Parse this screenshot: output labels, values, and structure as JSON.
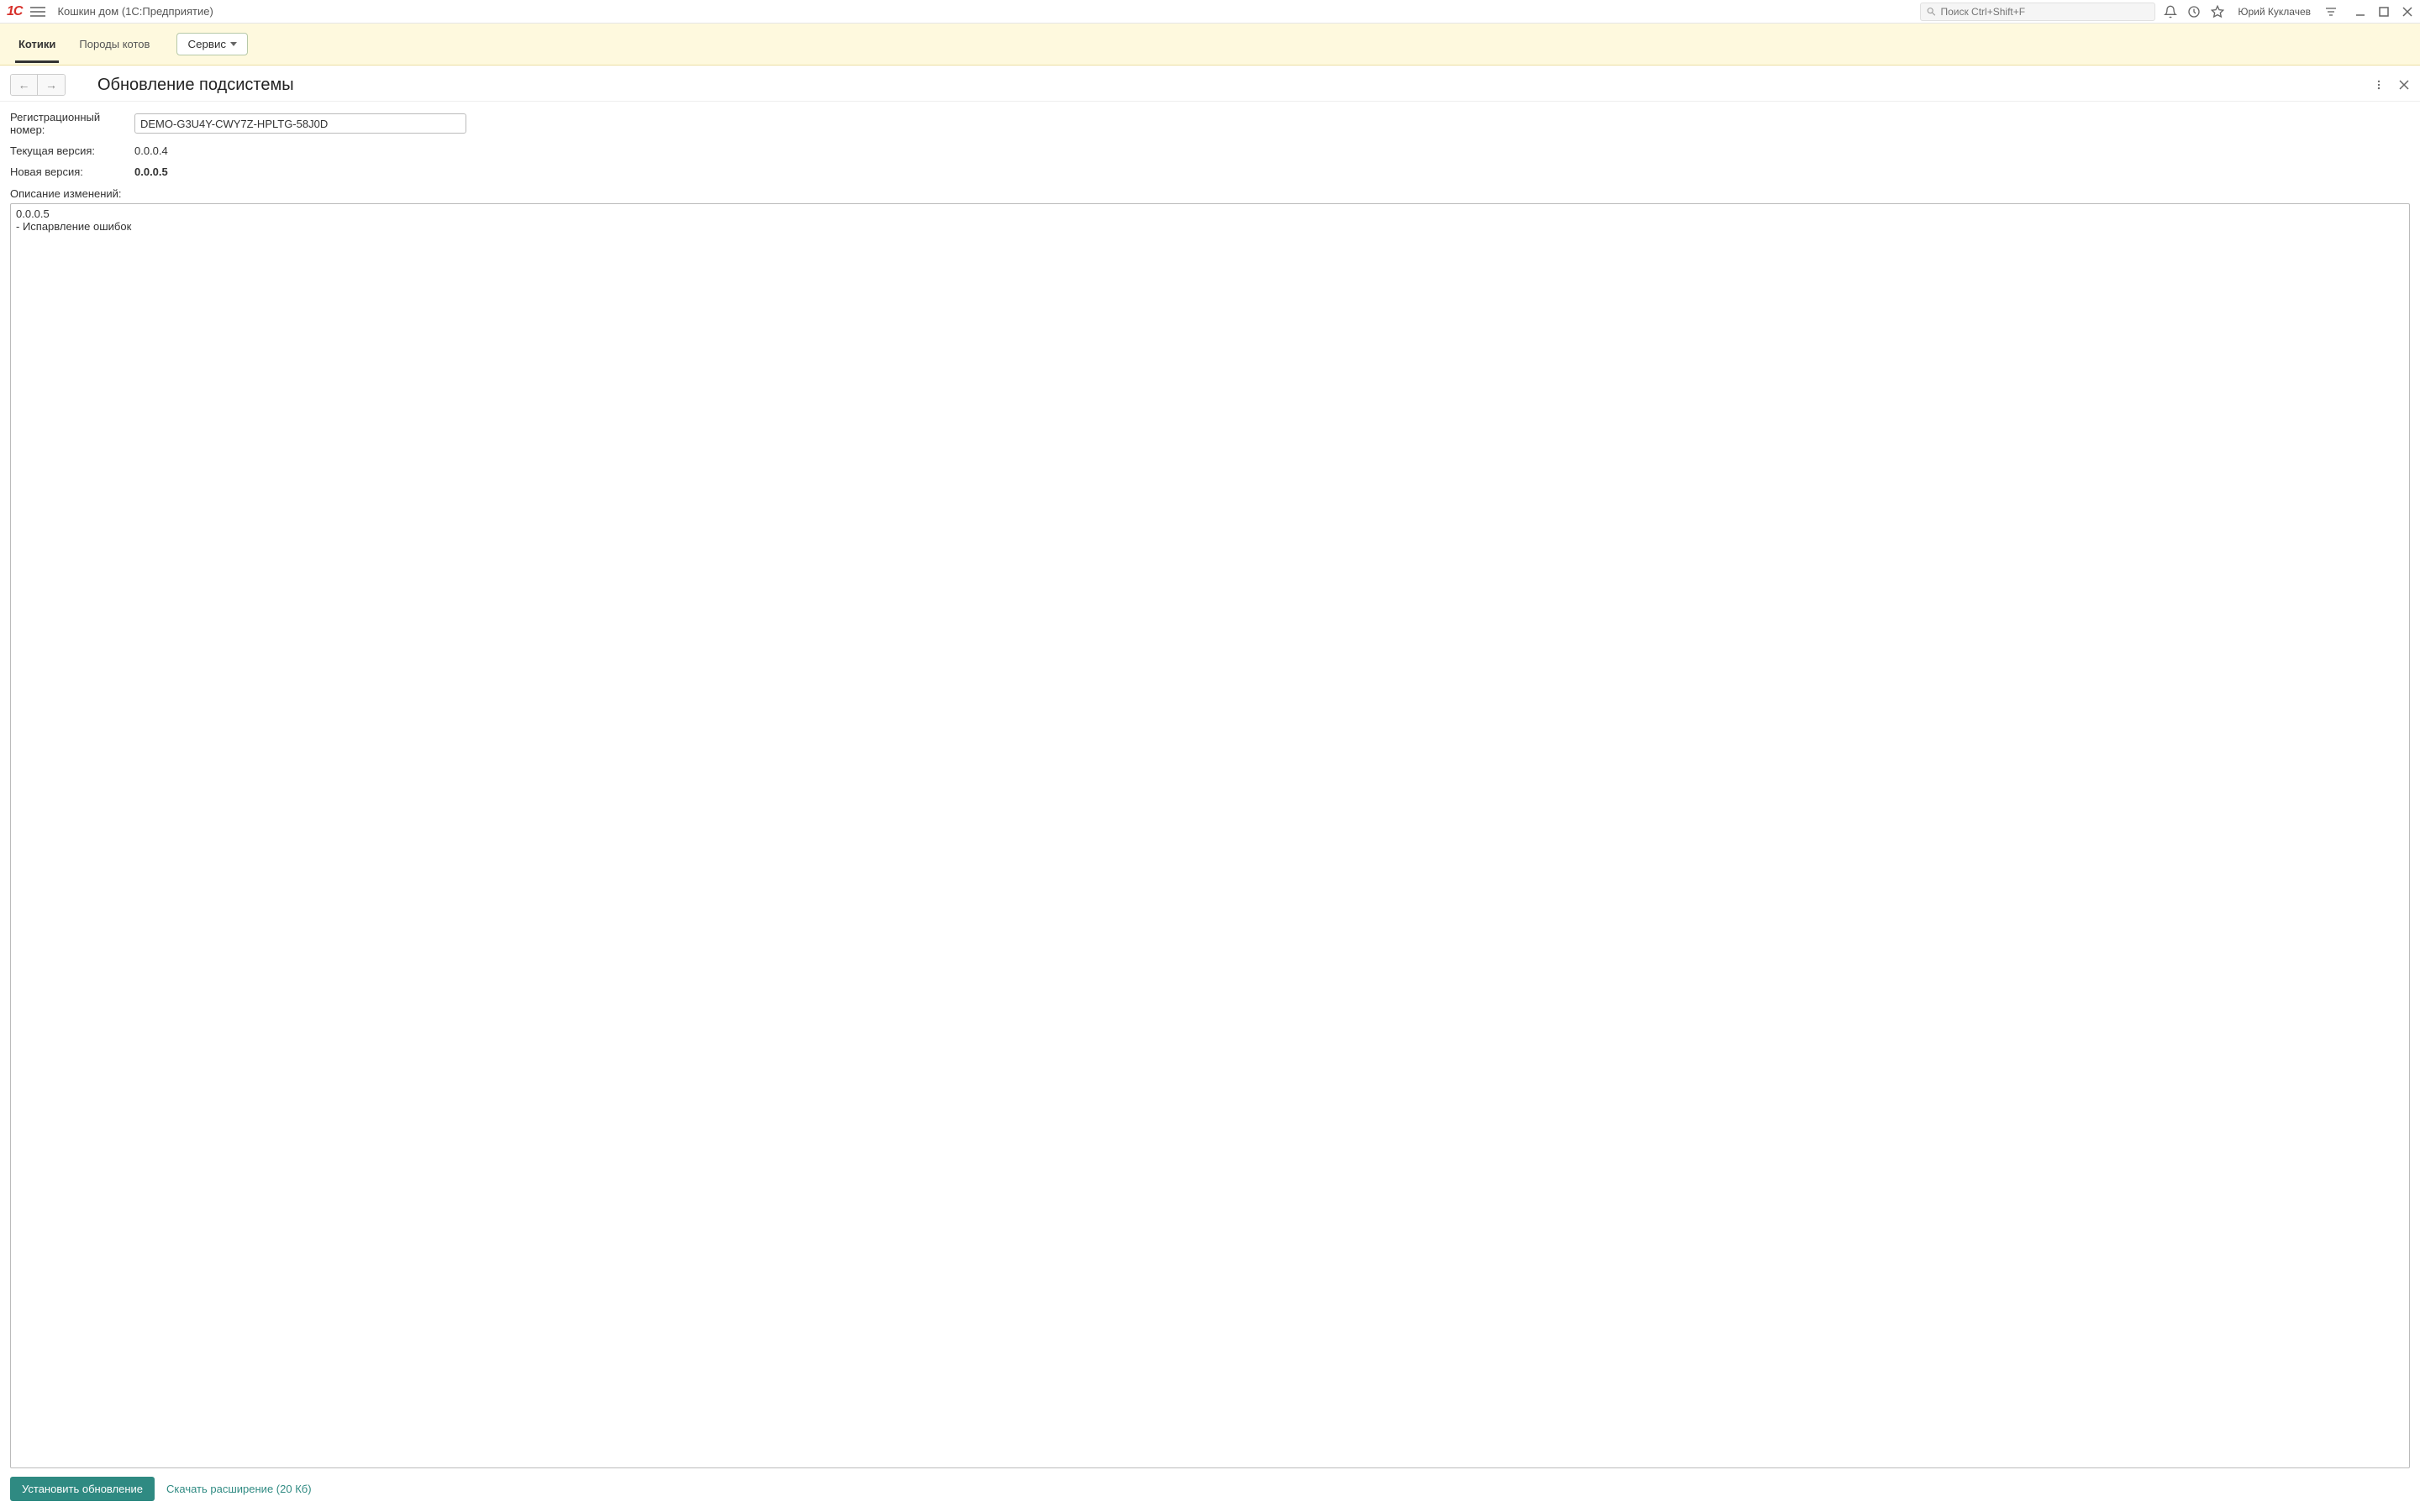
{
  "titlebar": {
    "app_name": "Кошкин дом",
    "app_suffix": "(1С:Предприятие)",
    "search_placeholder": "Поиск Ctrl+Shift+F",
    "username": "Юрий Куклачев"
  },
  "navbar": {
    "items": [
      "Котики",
      "Породы котов"
    ],
    "active_index": 0,
    "service_label": "Сервис"
  },
  "page": {
    "title": "Обновление подсистемы",
    "reg_label": "Регистрационный номер:",
    "reg_value": "DEMO-G3U4Y-CWY7Z-HPLTG-58J0D",
    "current_version_label": "Текущая версия:",
    "current_version_value": "0.0.0.4",
    "new_version_label": "Новая версия:",
    "new_version_value": "0.0.0.5",
    "changelog_label": "Описание изменений:",
    "changelog_text": "0.0.0.5\n- Испарвление ошибок",
    "install_button": "Установить обновление",
    "download_link": "Скачать расширение (20 Кб)"
  }
}
